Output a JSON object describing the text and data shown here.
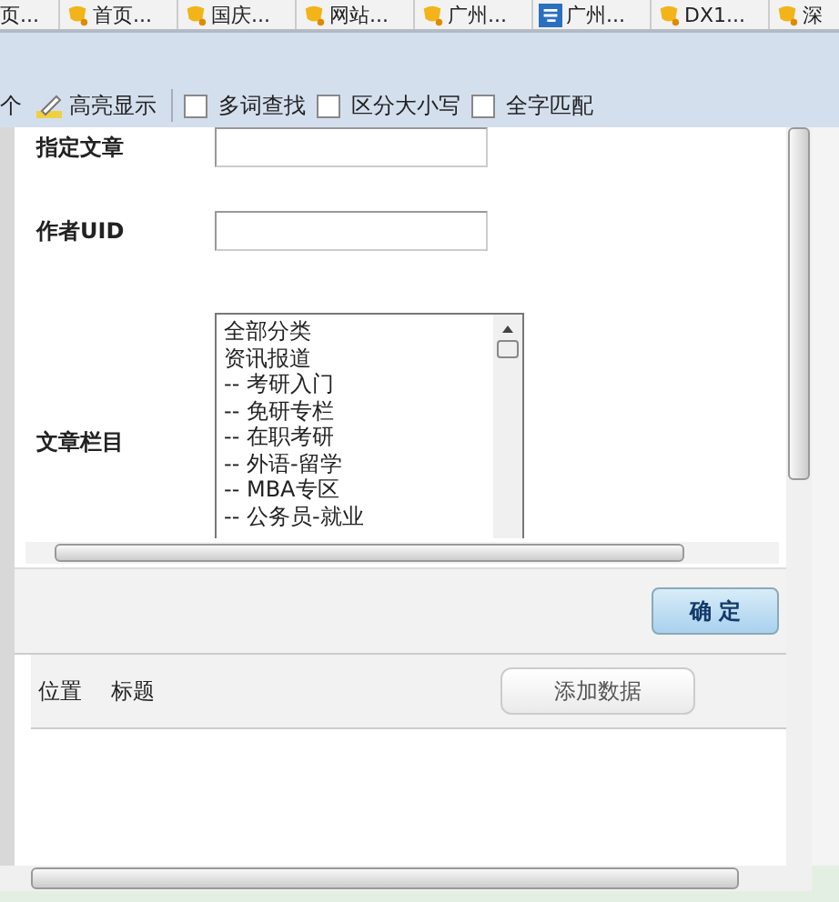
{
  "browser_tabs": [
    {
      "label": "页...",
      "kind": "plain"
    },
    {
      "label": "首页...",
      "kind": "bell"
    },
    {
      "label": "国庆...",
      "kind": "bell"
    },
    {
      "label": "网站...",
      "kind": "bell"
    },
    {
      "label": "广州...",
      "kind": "bell"
    },
    {
      "label": "广州...",
      "kind": "site"
    },
    {
      "label": "DX1...",
      "kind": "bell"
    },
    {
      "label": "深",
      "kind": "bell"
    }
  ],
  "find_bar": {
    "count_text": "个",
    "highlight": "高亮显示",
    "options": [
      {
        "label": "多词查找",
        "checked": false
      },
      {
        "label": "区分大小写",
        "checked": false
      },
      {
        "label": "全字匹配",
        "checked": false
      }
    ]
  },
  "form": {
    "fields": [
      {
        "label": "指定文章",
        "kind": "input"
      },
      {
        "label": "作者UID",
        "kind": "input"
      },
      {
        "label": "文章栏目",
        "kind": "list",
        "items": [
          "全部分类",
          "资讯报道",
          "-- 考研入门",
          "-- 免研专栏",
          "-- 在职考研",
          "-- 外语-留学",
          "-- MBA专区",
          "-- 公务员-就业"
        ]
      }
    ],
    "confirm": "确 定"
  },
  "table": {
    "columns": [
      "位置",
      "标题"
    ],
    "add_button": "添加数据"
  }
}
